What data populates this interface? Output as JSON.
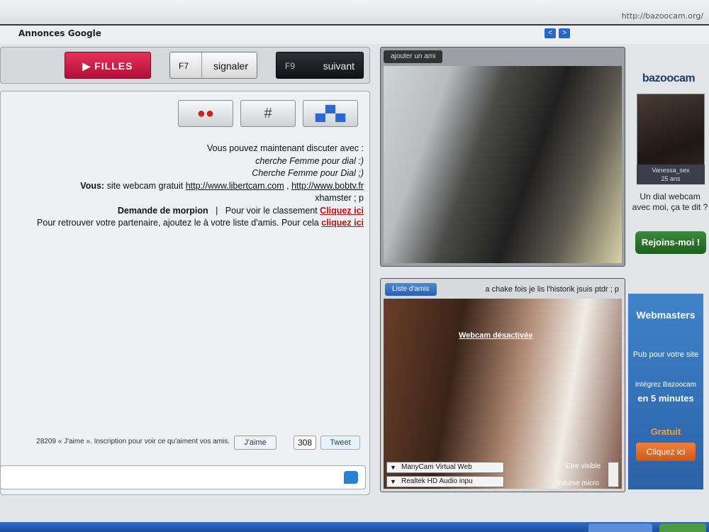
{
  "browser": {
    "url": "http://bazoocam.org/"
  },
  "ads": {
    "label": "Annonces Google",
    "prev": "<",
    "next": ">"
  },
  "sidebar": {
    "brand": "bazoocam",
    "profile_caption": "Vanessa_sex",
    "profile_age": "25 ans",
    "promo_text": "Un dial webcam avec moi, ça te dit ?",
    "join_button": "Rejoins-moi !",
    "webmasters": {
      "title": "Webmasters",
      "line1": "Pub pour votre site",
      "line2": "Intégrez Bazoocam",
      "line3": "en 5 minutes",
      "line4": "Gratuit",
      "cta": "Cliquez ici"
    }
  },
  "video_top": {
    "tag": "ajouter un ami"
  },
  "video_bottom": {
    "status_text": "a chake fois je lis l'historik jsuis ptdr ; p",
    "friends_button": "Liste d'amis",
    "webcam_off": "Webcam désactivée",
    "visible_label": "Etre visible",
    "video_source": "ManyCam Virtual Web",
    "audio_source": "Realtek HD Audio inpu",
    "mic_label": "Volume micro"
  },
  "toolbar": {
    "next_label": "suivant",
    "next_key": "F9",
    "report_label": "signaler",
    "report_key": "F7",
    "girls_label": "▶ FILLES"
  },
  "games": {
    "g1": "▄▀▄",
    "g2": "#",
    "g3": "●●"
  },
  "chat": {
    "intro": "Vous pouvez maintenant discuter avec :",
    "line1": "cherche Femme pour dial :)",
    "line2": "Cherche Femme pour Dial ;)",
    "you_label": "Vous:",
    "you_msg": " site webcam gratuit ",
    "link1": "http://www.libertcam.com",
    "sep": " , ",
    "link2": "http://www.bobtv.fr",
    "line3": "xhamster ; p",
    "game_req": "Demande de morpion",
    "rank_text": "Pour voir le classement ",
    "rank_link": "Cliquez ici",
    "partner_text": "Pour retrouver votre partenaire, ajoutez le à votre liste d'amis. Pour cela ",
    "partner_link": "cliquez ici"
  },
  "share": {
    "tweet": "Tweet",
    "tweet_count": "308",
    "like": "J'aime",
    "fb_text": "28209 « J'aime ». Inscription pour voir ce qu'aiment vos amis."
  }
}
